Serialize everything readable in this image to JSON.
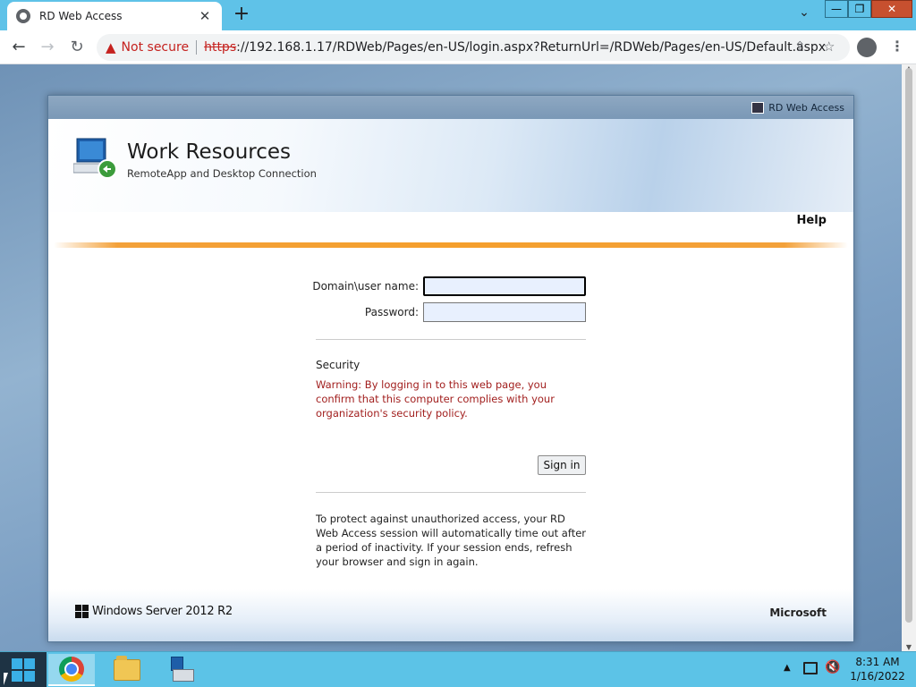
{
  "browser": {
    "tab_title": "RD Web Access",
    "tab_close": "✕",
    "new_tab": "+",
    "tab_search": "⌄",
    "window_buttons": {
      "minimize": "—",
      "maximize": "❐",
      "close": "✕"
    },
    "nav": {
      "back": "←",
      "forward": "→",
      "reload": "↻"
    },
    "security_label": "Not secure",
    "url_scheme": "https",
    "url_rest": "://192.168.1.17/RDWeb/Pages/en-US/login.aspx?ReturnUrl=/RDWeb/Pages/en-US/Default.aspx",
    "icons": {
      "share": "share-icon",
      "star": "star-icon",
      "profile": "profile-icon",
      "menu": "menu-icon"
    },
    "menu_glyph": "⋮",
    "star_glyph": "☆",
    "share_glyph": "⇪",
    "warn_glyph": "▲"
  },
  "panel": {
    "top_label": "RD Web Access",
    "title": "Work Resources",
    "subtitle": "RemoteApp and Desktop Connection",
    "help": "Help"
  },
  "form": {
    "username_label": "Domain\\user name:",
    "username_value": "",
    "password_label": "Password:",
    "password_value": "",
    "security_heading": "Security",
    "security_warning": "Warning: By logging in to this web page, you confirm that this computer complies with your organization's security policy.",
    "signin_label": "Sign in",
    "info_text": "To protect against unauthorized access, your RD Web Access session will automatically time out after a period of inactivity. If your session ends, refresh your browser and sign in again."
  },
  "footer": {
    "os_name": "Windows Server 2012 R2",
    "vendor": "Microsoft"
  },
  "taskbar": {
    "tray_arrow": "▲",
    "volume_glyph": "🔇",
    "time": "8:31 AM",
    "date": "1/16/2022"
  },
  "colors": {
    "taskbar": "#5cc3e7",
    "warning_text": "#a2201f",
    "accent_orange": "#f59f2c"
  }
}
